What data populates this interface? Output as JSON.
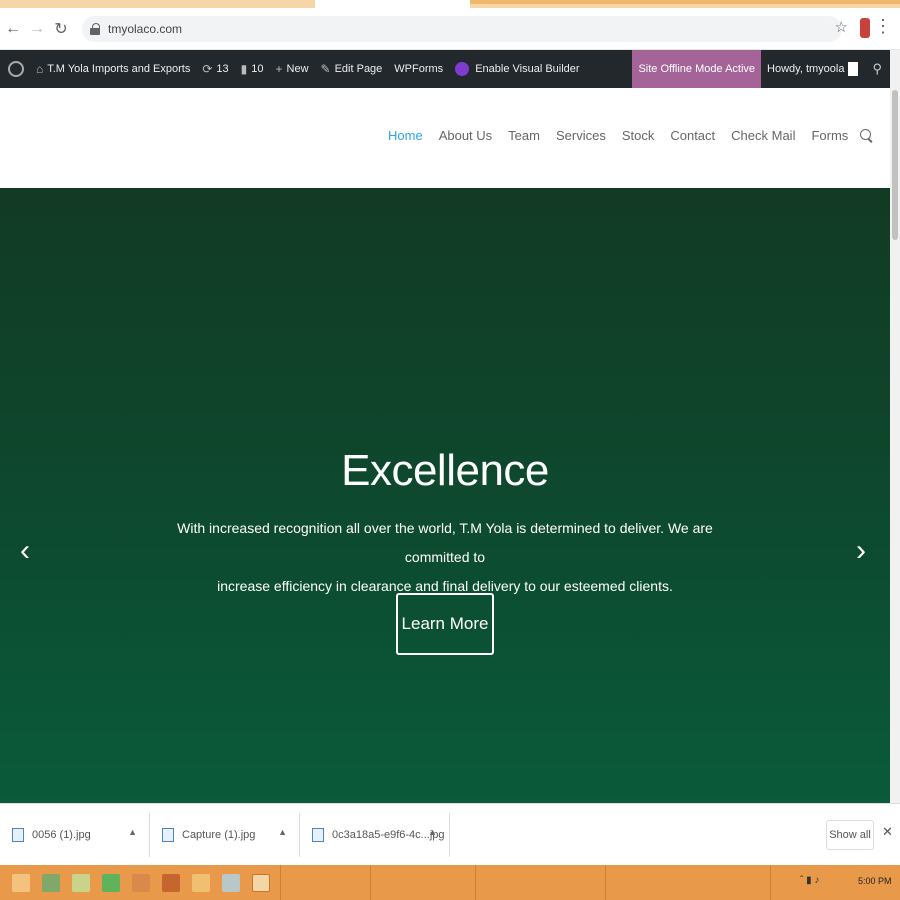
{
  "browser": {
    "url": "tmyolaco.com",
    "back_icon": "arrow-left-icon",
    "forward_icon": "arrow-right-icon",
    "reload_icon": "reload-icon"
  },
  "admin_bar": {
    "site_name": "T.M Yola Imports and Exports",
    "updates_count": "13",
    "comments_count": "10",
    "new_label": "New",
    "edit_page_label": "Edit Page",
    "wpforms_label": "WPForms",
    "visual_builder_label": "Enable Visual Builder",
    "offline_label": "Site Offline Mode Active",
    "howdy_label": "Howdy, tmyoola"
  },
  "nav": {
    "items": [
      "Home",
      "About Us",
      "Team",
      "Services",
      "Stock",
      "Contact",
      "Check Mail",
      "Forms"
    ],
    "active": "Home"
  },
  "hero": {
    "title": "Excellence",
    "text_line1": "With increased recognition all over the world, T.M Yola is determined to deliver. We are committed to",
    "text_line2": "increase efficiency in clearance and final delivery to our esteemed clients.",
    "button_label": "Learn More",
    "prev_arrow": "‹",
    "next_arrow": "›"
  },
  "downloads": {
    "items": [
      {
        "name": "0056 (1).jpg"
      },
      {
        "name": "Capture (1).jpg"
      },
      {
        "name": "0c3a18a5-e9f6-4c...jpg"
      }
    ],
    "show_all_label": "Show all"
  },
  "taskbar": {
    "clock": "5:00 PM"
  },
  "colors": {
    "nav_active": "#2ea3f2",
    "admin_bar": "#23282d",
    "offline_badge": "#a46497",
    "hero_top": "#123a24",
    "hero_bottom": "#0a5b3a",
    "taskbar": "#e89a4a"
  }
}
